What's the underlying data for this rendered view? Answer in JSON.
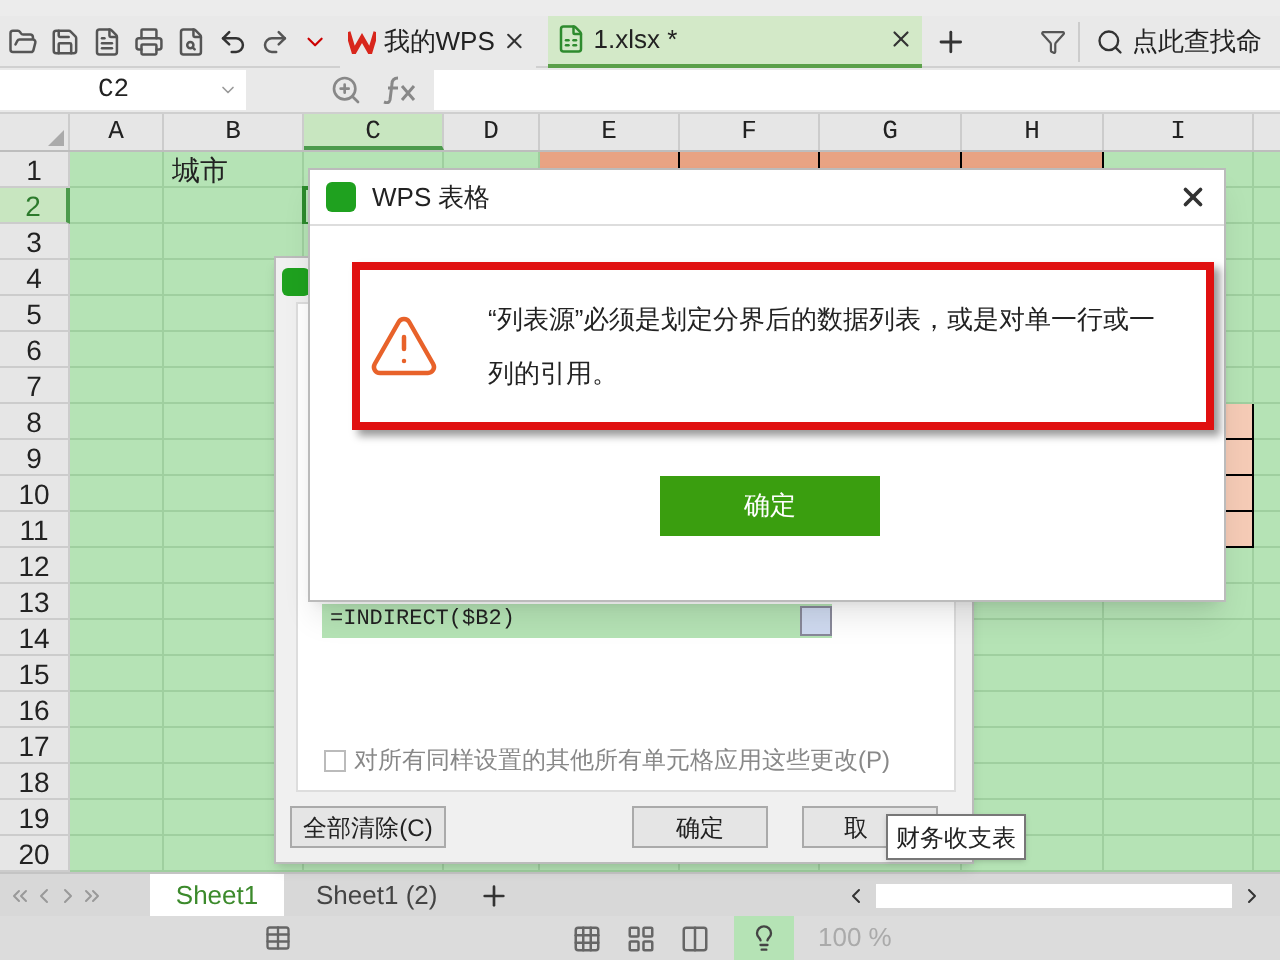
{
  "tabs": [
    {
      "label": "我的WPS",
      "kind": "wps",
      "selected": false
    },
    {
      "label": "1.xlsx *",
      "kind": "sheet",
      "selected": true
    }
  ],
  "search": {
    "placeholder": "点此查找命"
  },
  "name_box": {
    "value": "C2"
  },
  "grid": {
    "columns": [
      {
        "label": "A",
        "selected": false
      },
      {
        "label": "B",
        "selected": false
      },
      {
        "label": "C",
        "selected": true
      },
      {
        "label": "D",
        "selected": false
      },
      {
        "label": "E",
        "selected": false
      },
      {
        "label": "F",
        "selected": false
      },
      {
        "label": "G",
        "selected": false
      },
      {
        "label": "H",
        "selected": false
      },
      {
        "label": "I",
        "selected": false
      }
    ],
    "rows": [
      {
        "label": "1",
        "selected": false,
        "cells": [
          {
            "kind": "blank"
          },
          {
            "kind": "text",
            "text": "城市"
          },
          {
            "kind": "blank"
          },
          {
            "kind": "blank"
          },
          {
            "kind": "fill",
            "color": "#e8a383"
          },
          {
            "kind": "fill",
            "color": "#e8a383"
          },
          {
            "kind": "fill",
            "color": "#e8a383"
          },
          {
            "kind": "fill",
            "color": "#e8a383"
          }
        ]
      },
      {
        "label": "2",
        "selected": true,
        "cells": [
          {
            "kind": "blank"
          },
          {
            "kind": "blank"
          },
          {
            "kind": "blank",
            "active": true
          }
        ]
      },
      {
        "label": "3",
        "selected": false
      },
      {
        "label": "4",
        "selected": false
      },
      {
        "label": "5",
        "selected": false
      },
      {
        "label": "6",
        "selected": false
      },
      {
        "label": "7",
        "selected": false
      },
      {
        "label": "8",
        "selected": false,
        "cells": [
          {
            "kind": "blank"
          },
          {
            "kind": "blank"
          },
          {
            "kind": "blank"
          },
          {
            "kind": "blank"
          },
          {
            "kind": "blank"
          },
          {
            "kind": "blank"
          },
          {
            "kind": "blank"
          },
          {
            "kind": "blank"
          },
          {
            "kind": "fill",
            "color": "#f5cbb6"
          }
        ]
      },
      {
        "label": "9",
        "selected": false,
        "cells": [
          {
            "kind": "blank"
          },
          {
            "kind": "blank"
          },
          {
            "kind": "blank"
          },
          {
            "kind": "blank"
          },
          {
            "kind": "blank"
          },
          {
            "kind": "blank"
          },
          {
            "kind": "blank"
          },
          {
            "kind": "blank"
          },
          {
            "kind": "fill",
            "color": "#f5cbb6"
          }
        ]
      },
      {
        "label": "10",
        "selected": false,
        "cells": [
          {
            "kind": "blank"
          },
          {
            "kind": "blank"
          },
          {
            "kind": "blank"
          },
          {
            "kind": "blank"
          },
          {
            "kind": "blank"
          },
          {
            "kind": "blank"
          },
          {
            "kind": "blank"
          },
          {
            "kind": "blank"
          },
          {
            "kind": "fill",
            "color": "#f5cbb6"
          }
        ]
      },
      {
        "label": "11",
        "selected": false,
        "cells": [
          {
            "kind": "blank"
          },
          {
            "kind": "blank"
          },
          {
            "kind": "blank"
          },
          {
            "kind": "blank"
          },
          {
            "kind": "blank"
          },
          {
            "kind": "blank"
          },
          {
            "kind": "blank"
          },
          {
            "kind": "blank"
          },
          {
            "kind": "fill",
            "color": "#f5cbb6"
          }
        ]
      },
      {
        "label": "12",
        "selected": false
      },
      {
        "label": "13",
        "selected": false
      },
      {
        "label": "14",
        "selected": false
      },
      {
        "label": "15",
        "selected": false
      },
      {
        "label": "16",
        "selected": false
      },
      {
        "label": "17",
        "selected": false
      },
      {
        "label": "18",
        "selected": false
      },
      {
        "label": "19",
        "selected": false
      },
      {
        "label": "20",
        "selected": false
      }
    ]
  },
  "validation_dialog": {
    "source": "=INDIRECT($B2)",
    "apply_all": {
      "label": "对所有同样设置的其他所有单元格应用这些更改(P)",
      "checked": false
    },
    "buttons": [
      "全部清除(C)",
      "确定",
      "取"
    ]
  },
  "tooltip": "财务收支表",
  "alert": {
    "title": "WPS 表格",
    "message": "“列表源”必须是划定分界后的数据列表，或是对单一行或一列的引用。",
    "button": "确定"
  },
  "sheet_tabs": [
    {
      "label": "Sheet1",
      "selected": true
    },
    {
      "label": "Sheet1 (2)",
      "selected": false
    }
  ],
  "status_bar": {
    "zoom": "100 %"
  }
}
